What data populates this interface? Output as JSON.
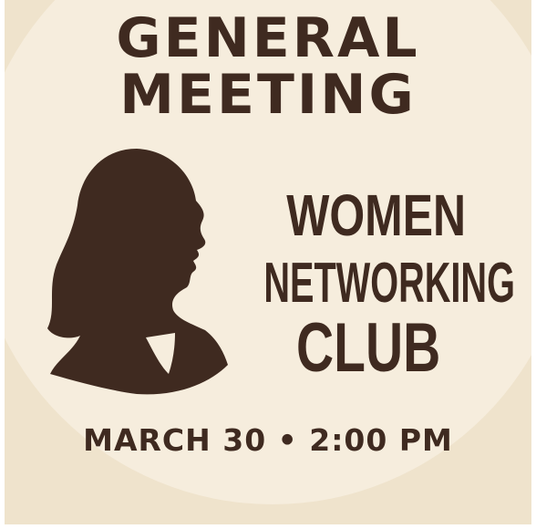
{
  "poster": {
    "heading_line1": "GENERAL",
    "heading_line2": "MEETING",
    "club_line1": "WOMEN",
    "club_line2": "NETWORKING",
    "club_line3": "CLUB",
    "date_time": "MARCH 30 • 2:00 PM",
    "icon": "woman-profile-silhouette-icon"
  },
  "colors": {
    "text": "#3f2a20",
    "background": "#efe3cc",
    "circle": "#f6eddd"
  }
}
